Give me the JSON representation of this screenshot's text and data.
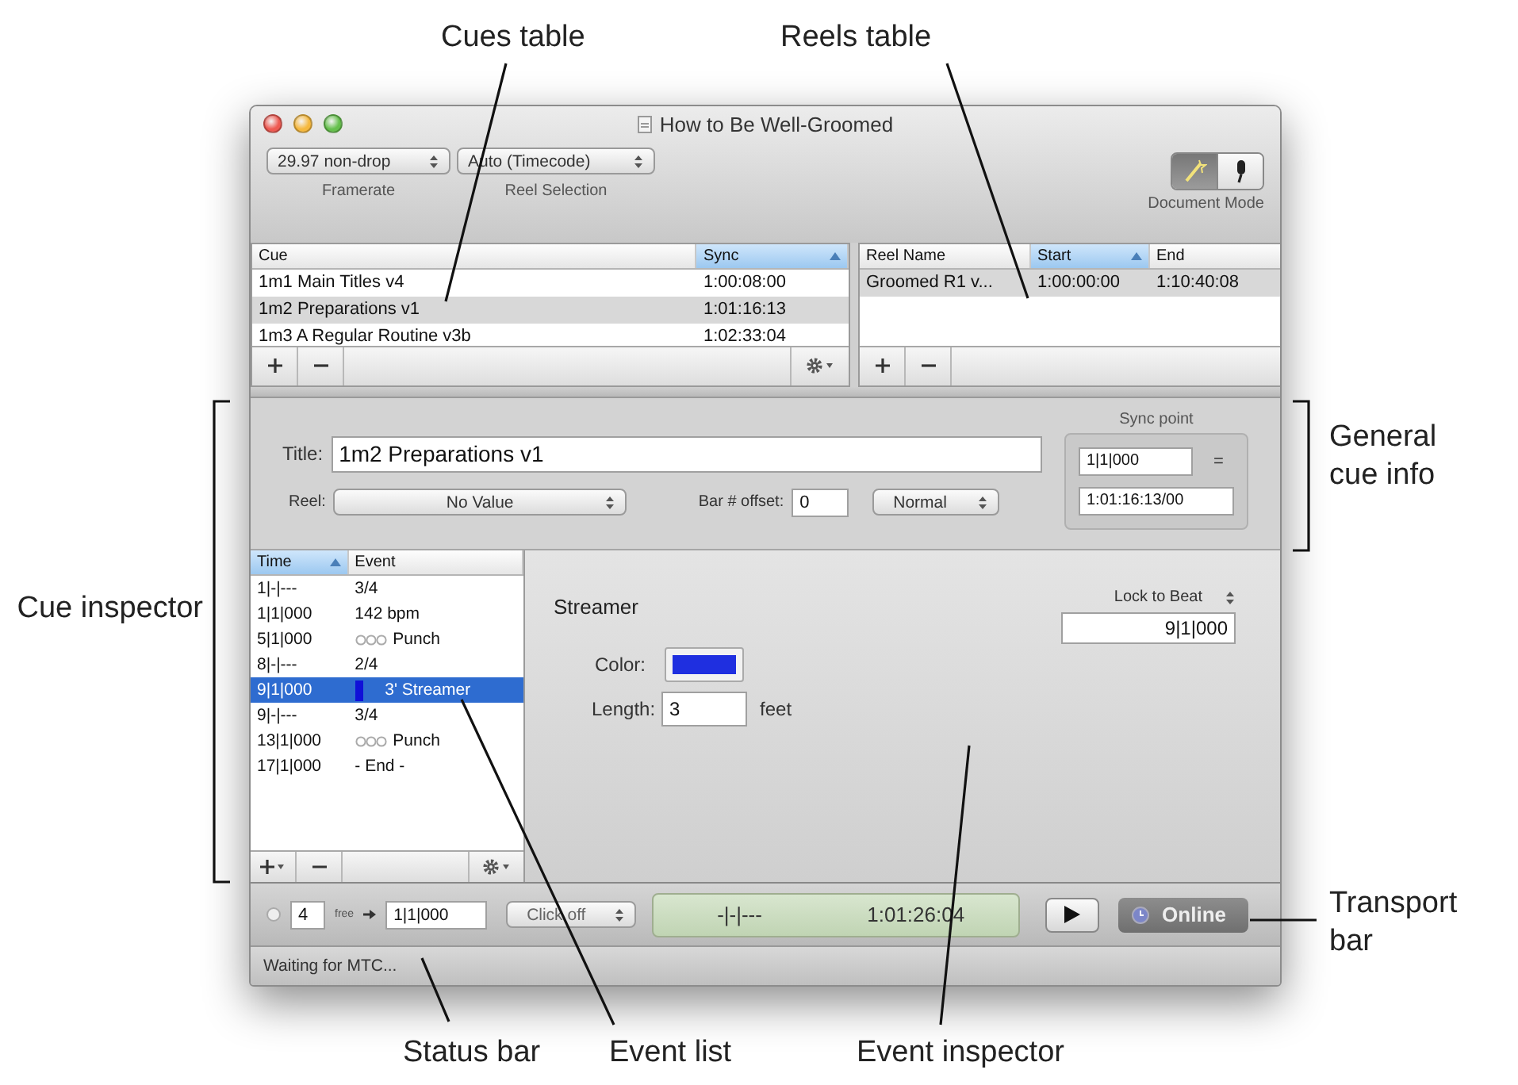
{
  "annotations": [
    {
      "label": "Cues table"
    },
    {
      "label": "Reels table"
    },
    {
      "label": "General cue info"
    },
    {
      "label": "Cue inspector"
    },
    {
      "label": "Transport bar"
    },
    {
      "label": "Status bar"
    },
    {
      "label": "Event list"
    },
    {
      "label": "Event inspector"
    }
  ],
  "window": {
    "title": "How to Be Well-Groomed"
  },
  "toolbar": {
    "popups": [
      {
        "value": "29.97 non-drop",
        "caption": "Framerate"
      },
      {
        "value": "Auto (Timecode)",
        "caption": "Reel Selection"
      }
    ],
    "document_mode": {
      "caption": "Document Mode",
      "segments": [
        {
          "selected": true
        },
        {
          "selected": false
        }
      ]
    }
  },
  "cues_table": {
    "columns": [
      {
        "label": "Cue",
        "sorted": false
      },
      {
        "label": "Sync",
        "sorted": true
      }
    ],
    "rows": [
      {
        "cells": [
          "1m1 Main Titles v4",
          "1:00:08:00"
        ],
        "selected": false
      },
      {
        "cells": [
          "1m2 Preparations v1",
          "1:01:16:13"
        ],
        "selected": true
      },
      {
        "cells": [
          "1m3 A Regular Routine v3b",
          "1:02:33:04"
        ],
        "selected": false
      }
    ]
  },
  "reels_table": {
    "columns": [
      {
        "label": "Reel Name",
        "sorted": false
      },
      {
        "label": "Start",
        "sorted": true
      },
      {
        "label": "End",
        "sorted": false
      }
    ],
    "rows": [
      {
        "cells": [
          "Groomed R1 v...",
          "1:00:00:00",
          "1:10:40:08"
        ],
        "selected": true
      }
    ]
  },
  "cue_info": {
    "title_label": "Title:",
    "title_value": "1m2 Preparations v1",
    "reel_label": "Reel:",
    "reel_value": "No Value",
    "offset_label": "Bar # offset:",
    "offset_value": "0",
    "mode_value": "Normal",
    "sync_point": {
      "label": "Sync point",
      "bar": "1|1|000",
      "equals": "=",
      "timecode": "1:01:16:13/00"
    }
  },
  "event_list": {
    "columns": [
      {
        "label": "Time",
        "sorted": true
      },
      {
        "label": "Event",
        "sorted": false
      }
    ],
    "rows": [
      {
        "time": "1|-|---",
        "event": "3/4",
        "kind": "text",
        "selected": false
      },
      {
        "time": "1|1|000",
        "event": "142 bpm",
        "kind": "text",
        "selected": false
      },
      {
        "time": "5|1|000",
        "event": "Punch",
        "kind": "punch",
        "selected": false
      },
      {
        "time": "8|-|---",
        "event": "2/4",
        "kind": "text",
        "selected": false
      },
      {
        "time": "9|1|000",
        "event": "3' Streamer",
        "kind": "streamer",
        "color": "#1010d8",
        "selected": true
      },
      {
        "time": "9|-|---",
        "event": "3/4",
        "kind": "text",
        "selected": false
      },
      {
        "time": "13|1|000",
        "event": "Punch",
        "kind": "punch",
        "selected": false
      },
      {
        "time": "17|1|000",
        "event": "- End -",
        "kind": "text",
        "selected": false
      }
    ]
  },
  "event_inspector": {
    "title": "Streamer",
    "lock_label": "Lock to Beat",
    "lock_value": "9|1|000",
    "color_label": "Color:",
    "color": "#1f2fe0",
    "length_label": "Length:",
    "length_value": "3",
    "length_unit": "feet"
  },
  "transport": {
    "radio_selected": false,
    "count": "4",
    "free_label": "free",
    "position": "1|1|000",
    "click_value": "Click off",
    "display_bars": "-|-|---",
    "display_time": "1:01:26:04",
    "online_label": "Online"
  },
  "status_bar": {
    "text": "Waiting for MTC..."
  }
}
